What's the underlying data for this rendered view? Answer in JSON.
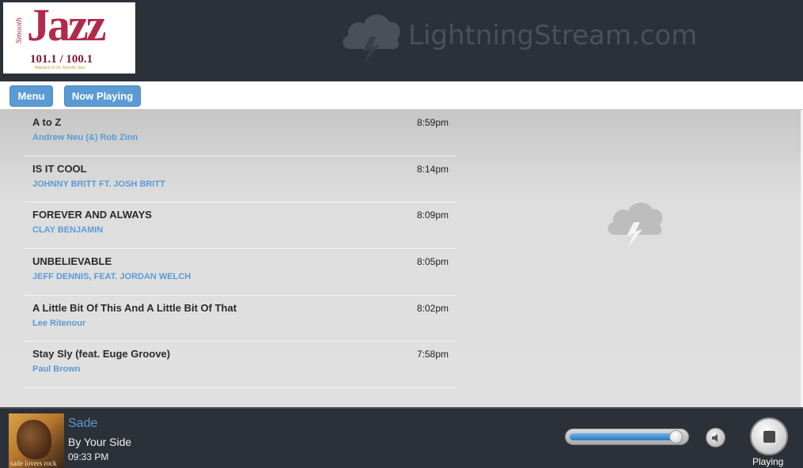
{
  "header": {
    "logo": {
      "script": "Smooth",
      "main": "Jazz",
      "frequency": "101.1 / 100.1",
      "tagline": "Atlanta's #1 for Smooth Jazz"
    },
    "brand": "LightningStream.com"
  },
  "nav": {
    "menu_label": "Menu",
    "now_playing_label": "Now Playing"
  },
  "playlist": [
    {
      "song": "A to Z",
      "artist": "Andrew Neu (&) Rob Zinn",
      "time": "8:59pm"
    },
    {
      "song": "IS IT COOL",
      "artist": "JOHNNY BRITT FT. JOSH BRITT",
      "time": "8:14pm"
    },
    {
      "song": "FOREVER AND ALWAYS",
      "artist": "CLAY BENJAMIN",
      "time": "8:09pm"
    },
    {
      "song": "UNBELIEVABLE",
      "artist": "JEFF DENNIS, FEAT. JORDAN WELCH",
      "time": "8:05pm"
    },
    {
      "song": "A Little Bit Of This And A Little Bit Of That",
      "artist": "Lee Ritenour",
      "time": "8:02pm"
    },
    {
      "song": "Stay Sly (feat. Euge Groove)",
      "artist": "Paul Brown",
      "time": "7:58pm"
    }
  ],
  "player": {
    "artist": "Sade",
    "song": "By Your Side",
    "time": "09:33 PM",
    "album_text": "sade lovers rock",
    "volume": 0.93,
    "status": "Playing"
  },
  "colors": {
    "accent": "#5a9bd4",
    "header_bg": "#2c3038"
  },
  "icons": {
    "brand": "lightning-cloud-icon",
    "speaker": "speaker-icon",
    "stop": "stop-icon"
  }
}
